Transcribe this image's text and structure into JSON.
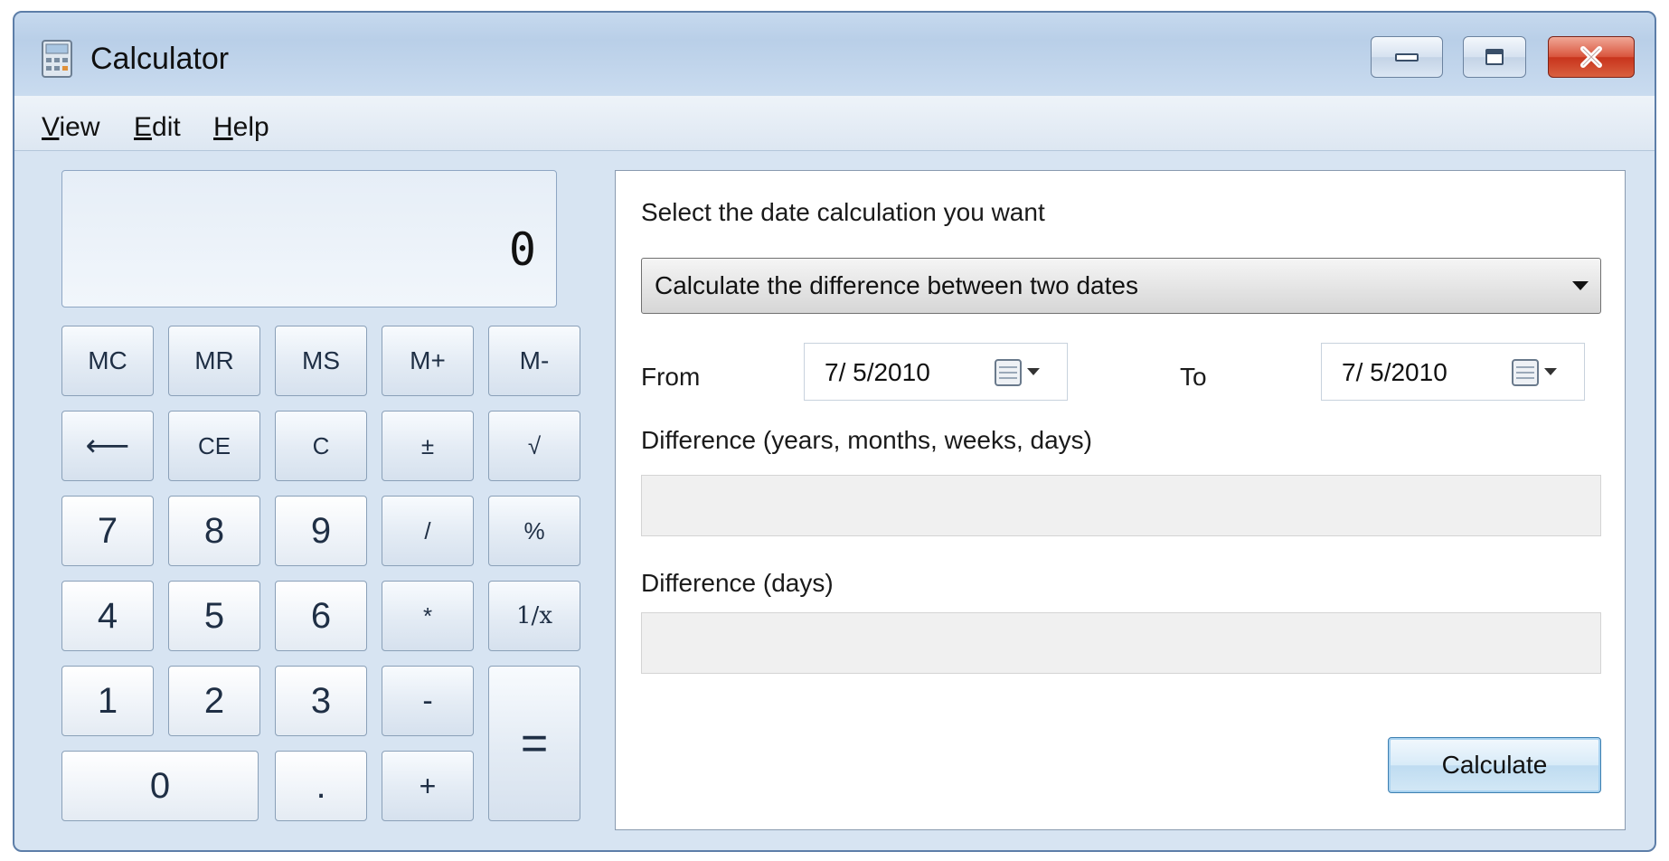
{
  "window": {
    "title": "Calculator",
    "app_icon": "calculator-icon"
  },
  "title_buttons": {
    "minimize_icon": "minimize-icon",
    "restore_icon": "restore-icon",
    "close_icon": "close-icon"
  },
  "menu": {
    "items": [
      {
        "label": "View",
        "mnemonic": "V"
      },
      {
        "label": "Edit",
        "mnemonic": "E"
      },
      {
        "label": "Help",
        "mnemonic": "H"
      }
    ]
  },
  "calculator": {
    "display": "0",
    "keys": {
      "mc": "MC",
      "mr": "MR",
      "ms": "MS",
      "m_plus": "M+",
      "m_minus": "M-",
      "backspace": "⟵",
      "ce": "CE",
      "c": "C",
      "plus_minus": "±",
      "sqrt": "√",
      "d7": "7",
      "d8": "8",
      "d9": "9",
      "divide": "/",
      "percent": "%",
      "d4": "4",
      "d5": "5",
      "d6": "6",
      "multiply": "*",
      "reciprocal": "1/x",
      "d1": "1",
      "d2": "2",
      "d3": "3",
      "subtract": "-",
      "equals": "=",
      "d0": "0",
      "decimal": ".",
      "add": "+"
    }
  },
  "date_calc": {
    "prompt": "Select the date calculation you want",
    "mode_selected": "Calculate the difference between two dates",
    "from_label": "From",
    "from_date": "7/ 5/2010",
    "to_label": "To",
    "to_date": "7/ 5/2010",
    "diff_ymwd_label": "Difference (years, months, weeks, days)",
    "diff_ymwd_value": "",
    "diff_days_label": "Difference (days)",
    "diff_days_value": "",
    "calculate_label": "Calculate"
  }
}
